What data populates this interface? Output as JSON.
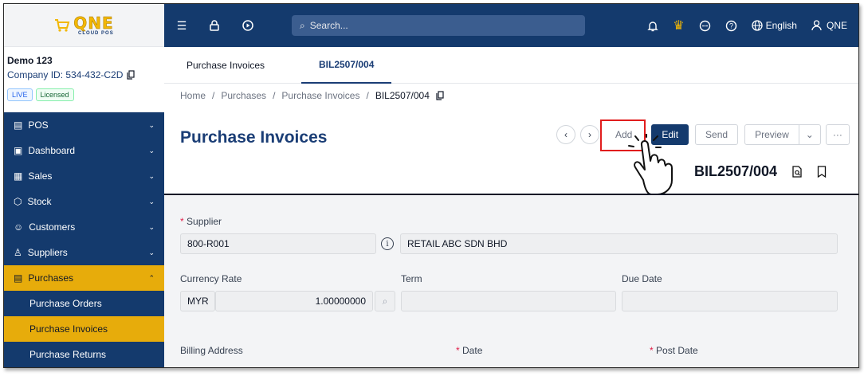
{
  "logo": {
    "main": "QNE",
    "sub": "CLOUD POS"
  },
  "company": {
    "name": "Demo 123",
    "id": "Company ID: 534-432-C2D",
    "badge_live": "LIVE",
    "badge_licensed": "Licensed"
  },
  "sidebar": {
    "items": [
      {
        "label": "POS",
        "icon": "pos-icon"
      },
      {
        "label": "Dashboard",
        "icon": "dashboard-icon"
      },
      {
        "label": "Sales",
        "icon": "sales-icon"
      },
      {
        "label": "Stock",
        "icon": "stock-icon"
      },
      {
        "label": "Customers",
        "icon": "customers-icon"
      },
      {
        "label": "Suppliers",
        "icon": "suppliers-icon"
      },
      {
        "label": "Purchases",
        "icon": "purchases-icon"
      }
    ],
    "sub_items": [
      {
        "label": "Purchase Orders"
      },
      {
        "label": "Purchase Invoices"
      },
      {
        "label": "Purchase Returns"
      }
    ]
  },
  "topbar": {
    "search_placeholder": "Search...",
    "language": "English",
    "user": "QNE"
  },
  "tabs": [
    {
      "label": "Purchase Invoices"
    },
    {
      "label": "BIL2507/004"
    }
  ],
  "breadcrumb": {
    "home": "Home",
    "purchases": "Purchases",
    "invoices": "Purchase Invoices",
    "current": "BIL2507/004"
  },
  "page": {
    "title": "Purchase Invoices",
    "doc_no": "BIL2507/004"
  },
  "actions": {
    "add": "Add",
    "edit": "Edit",
    "send": "Send",
    "preview": "Preview",
    "more": "···"
  },
  "form": {
    "supplier_label": "Supplier",
    "supplier_code": "800-R001",
    "supplier_name": "RETAIL ABC SDN BHD",
    "currency_rate_label": "Currency Rate",
    "currency": "MYR",
    "rate": "1.00000000",
    "term_label": "Term",
    "due_date_label": "Due Date",
    "billing_address_label": "Billing Address",
    "date_label": "Date",
    "post_date_label": "Post Date"
  },
  "colors": {
    "primary": "#143a6d",
    "accent": "#e7ac0b",
    "highlight": "#e11d1d"
  }
}
